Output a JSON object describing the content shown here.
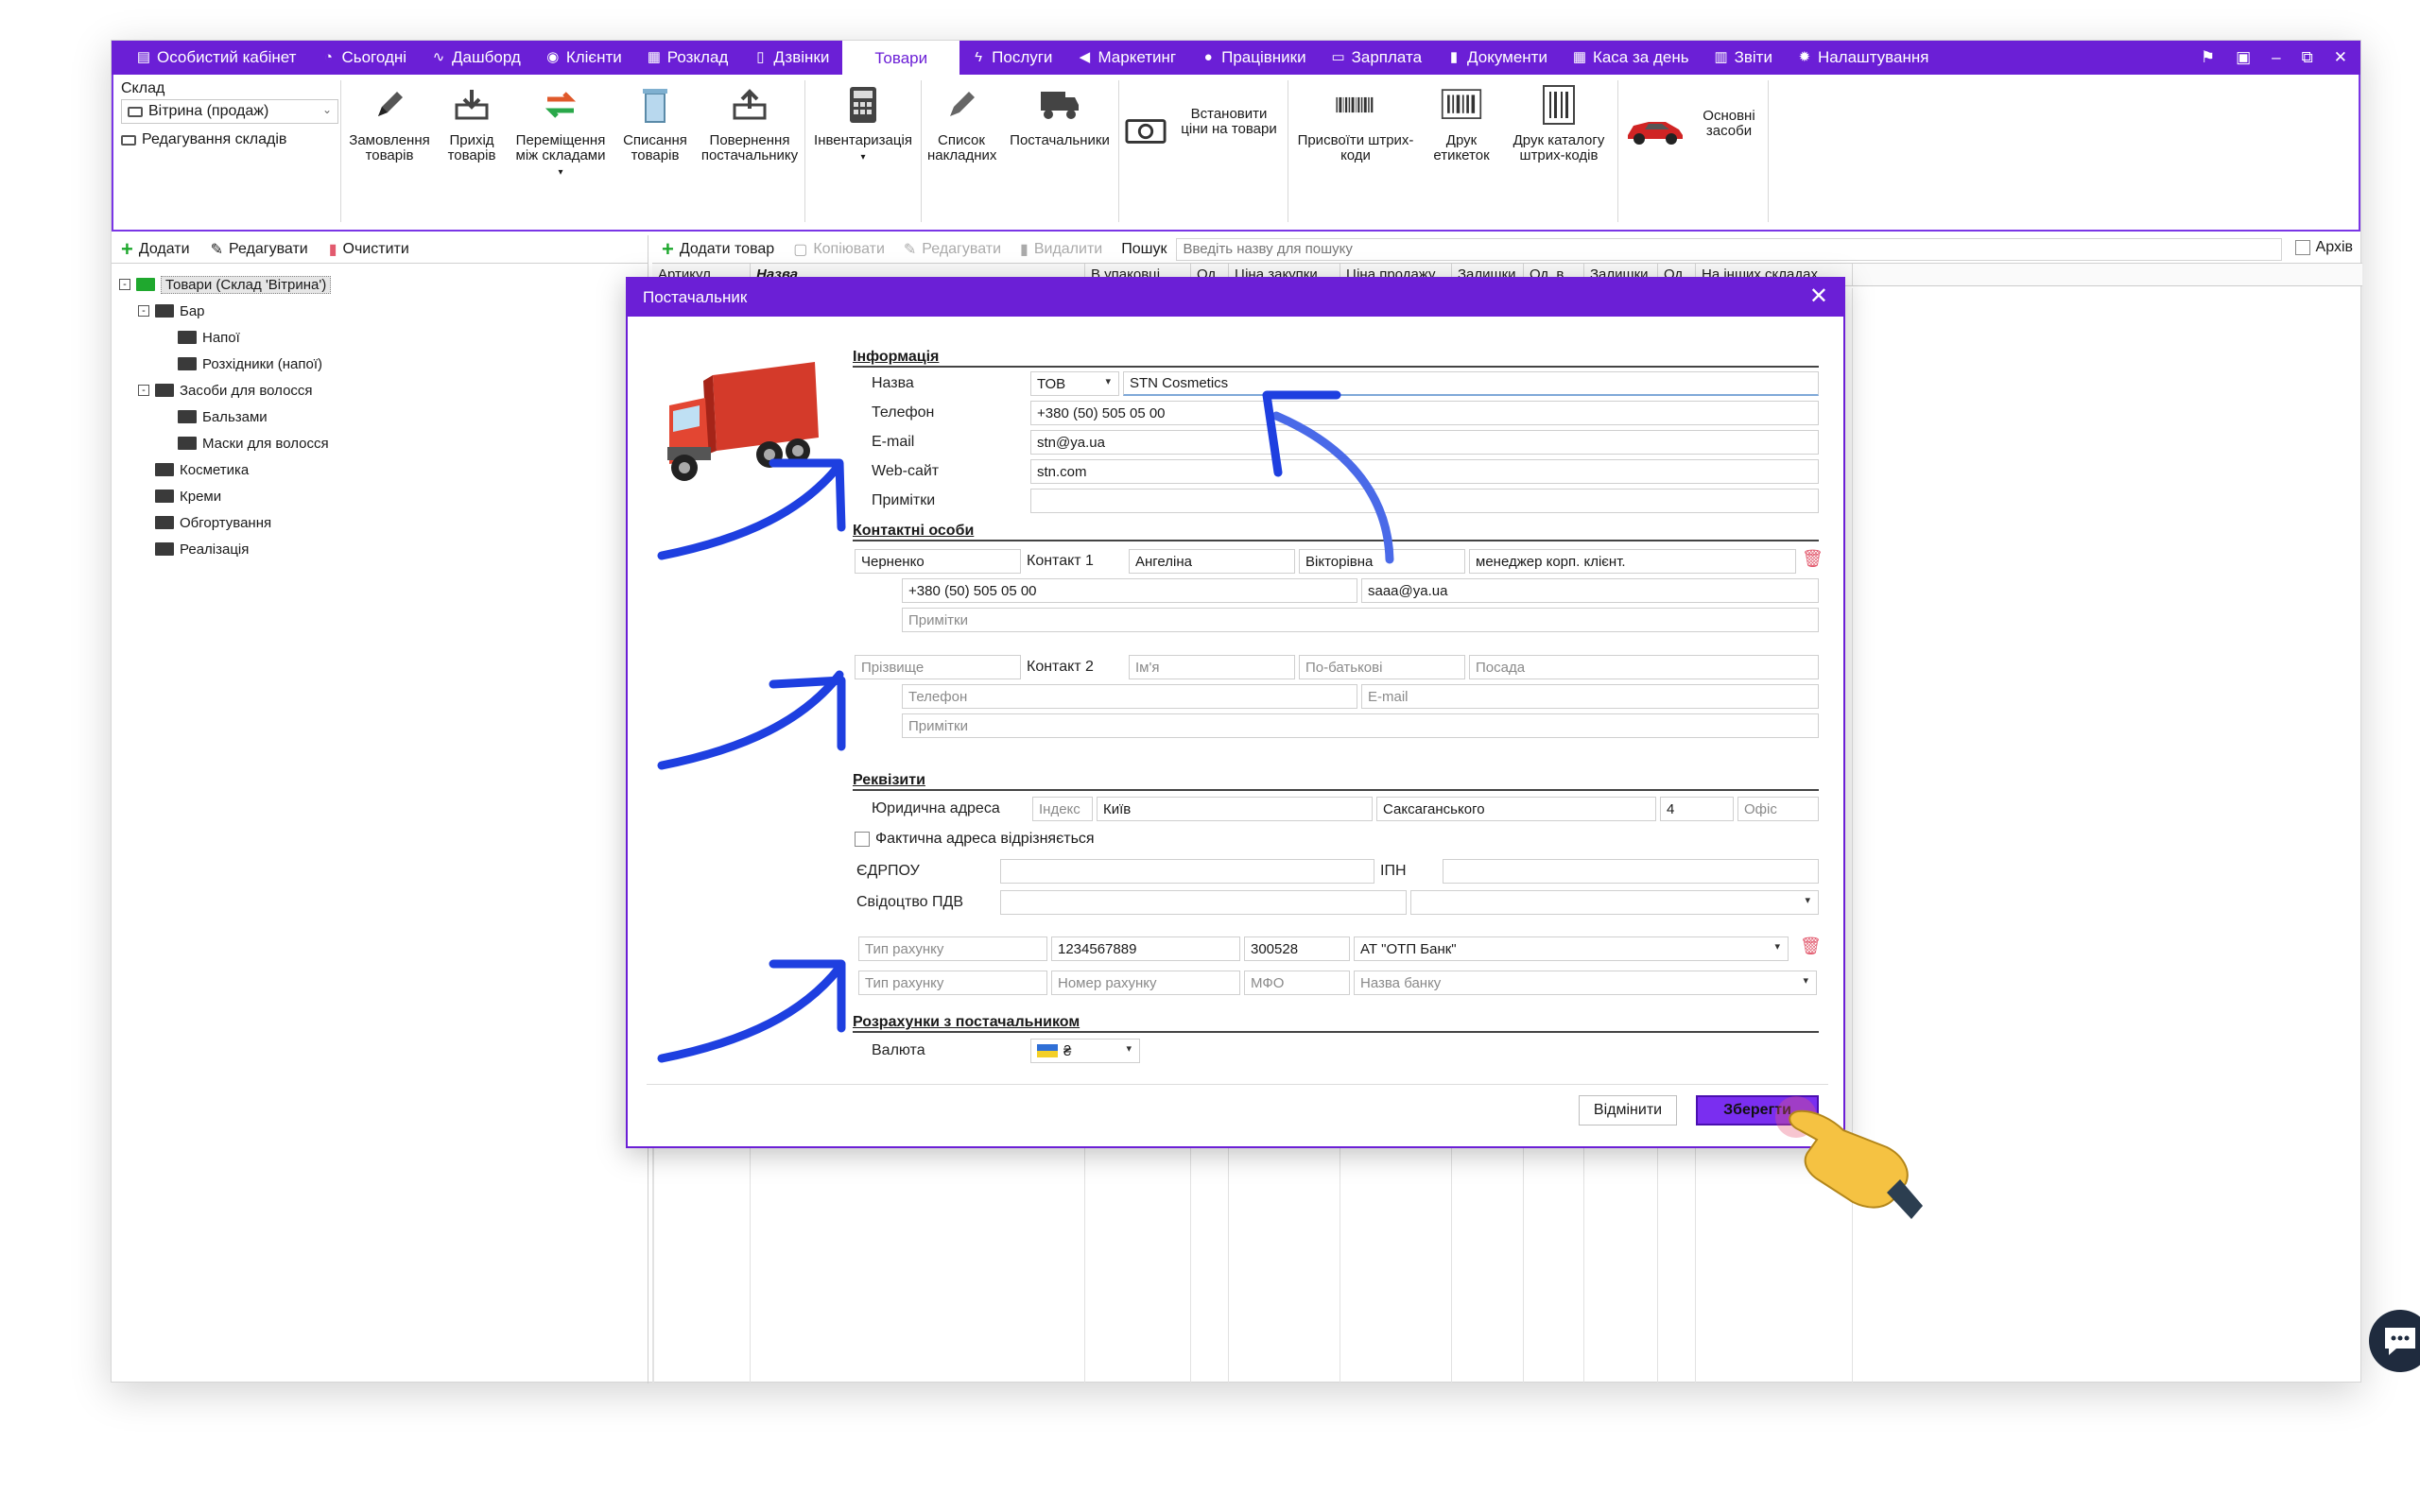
{
  "topnav": {
    "items": [
      {
        "label": "Особистий кабінет",
        "icon": "briefcase-icon"
      },
      {
        "label": "Сьогодні",
        "icon": "clock-icon"
      },
      {
        "label": "Дашборд",
        "icon": "pulse-icon"
      },
      {
        "label": "Клієнти",
        "icon": "user-circle-icon"
      },
      {
        "label": "Розклад",
        "icon": "calendar-icon"
      },
      {
        "label": "Дзвінки",
        "icon": "phone-icon"
      },
      {
        "label": "Товари",
        "icon": "",
        "active": true
      },
      {
        "label": "Послуги",
        "icon": "lightning-icon"
      },
      {
        "label": "Маркетинг",
        "icon": "megaphone-icon"
      },
      {
        "label": "Працівники",
        "icon": "person-icon"
      },
      {
        "label": "Зарплата",
        "icon": "money-icon"
      },
      {
        "label": "Документи",
        "icon": "document-icon"
      },
      {
        "label": "Каса за день",
        "icon": "calculator-icon"
      },
      {
        "label": "Звіти",
        "icon": "bar-chart-icon"
      },
      {
        "label": "Налаштування",
        "icon": "gear-icon"
      }
    ]
  },
  "ribbon": {
    "warehouse_label": "Склад",
    "warehouse_value": "Вітрина (продаж)",
    "edit_warehouses": "Редагування складів",
    "tools": [
      {
        "label": "Замовлення товарів",
        "icon": "pencil-icon"
      },
      {
        "label": "Прихід товарів",
        "icon": "inbox-in-icon"
      },
      {
        "label": "Переміщення між складами",
        "icon": "transfer-icon"
      },
      {
        "label": "Списання товарів",
        "icon": "trash-can-icon"
      },
      {
        "label": "Повернення постачальнику",
        "icon": "return-icon"
      },
      {
        "label": "Інвентаризація",
        "icon": "calculator-icon"
      },
      {
        "label": "Список накладних",
        "icon": "list-pencil-icon"
      },
      {
        "label": "Постачальники",
        "icon": "truck-icon"
      },
      {
        "label": "Встановити ціни на товари",
        "icon": "cash-icon"
      },
      {
        "label": "Присвоїти штрих-коди",
        "icon": "barcode-icon"
      },
      {
        "label": "Друк етикеток",
        "icon": "label-barcode-icon"
      },
      {
        "label": "Друк каталогу штрих-кодів",
        "icon": "catalog-barcode-icon"
      },
      {
        "label": "Основні засоби",
        "icon": "car-icon"
      }
    ]
  },
  "left": {
    "add": "Додати",
    "edit": "Редагувати",
    "clear": "Очистити",
    "tree": [
      {
        "label": "Товари (Склад 'Вітрина')",
        "level": 0,
        "expander": "-",
        "root": true
      },
      {
        "label": "Бар",
        "level": 1,
        "expander": "-"
      },
      {
        "label": "Напої",
        "level": 2
      },
      {
        "label": "Розхідники (напої)",
        "level": 2
      },
      {
        "label": "Засоби для волосся",
        "level": 1,
        "expander": "-"
      },
      {
        "label": "Бальзами",
        "level": 2
      },
      {
        "label": "Маски для волосся",
        "level": 2
      },
      {
        "label": "Косметика",
        "level": 1
      },
      {
        "label": "Креми",
        "level": 1
      },
      {
        "label": "Обгортування",
        "level": 1
      },
      {
        "label": "Реалізація",
        "level": 1
      }
    ]
  },
  "right": {
    "add_product": "Додати товар",
    "copy": "Копіювати",
    "edit": "Редагувати",
    "delete": "Видалити",
    "search_label": "Пошук",
    "search_placeholder": "Введіть назву для пошуку",
    "archive": "Архів",
    "columns": [
      "Артикул",
      "Назва",
      "В упаковці",
      "Од...",
      "Ціна закупки",
      "Ціна продажу",
      "Залишки",
      "Од. в...",
      "Залишки",
      "Од...",
      "На інших складах"
    ]
  },
  "modal": {
    "title": "Постачальник",
    "sec_info": "Інформація",
    "name_label": "Назва",
    "name_type": "ТОВ",
    "name_value": "STN Cosmetics",
    "phone_label": "Телефон",
    "phone_value": "+380 (50) 505 05 00",
    "email_label": "E-mail",
    "email_value": "stn@ya.ua",
    "web_label": "Web-сайт",
    "web_value": "stn.com",
    "notes_label": "Примітки",
    "sec_contacts": "Контактні особи",
    "c1": {
      "surname": "Черненко",
      "label": "Контакт 1",
      "name": "Ангеліна",
      "patronymic": "Вікторівна",
      "position": "менеджер корп. клієнт.",
      "phone": "+380 (50) 505 05 00",
      "email": "saaa@ya.ua",
      "notes_ph": "Примітки"
    },
    "c2": {
      "surname_ph": "Прізвище",
      "label": "Контакт 2",
      "name_ph": "Ім'я",
      "patronymic_ph": "По-батькові",
      "position_ph": "Посада",
      "phone_ph": "Телефон",
      "email_ph": "E-mail",
      "notes_ph": "Примітки"
    },
    "sec_req": "Реквізити",
    "legal_addr_label": "Юридична адреса",
    "index_ph": "Індекс",
    "city": "Київ",
    "street": "Саксаганського",
    "house": "4",
    "office_ph": "Офіс",
    "actual_addr": "Фактична адреса відрізняється",
    "edrpou_label": "ЄДРПОУ",
    "ipn_label": "ІПН",
    "vat_label": "Свідоцтво ПДВ",
    "acc1": {
      "type_ph": "Тип рахунку",
      "number": "1234567889",
      "mfo": "300528",
      "bank": "АТ \"ОТП Банк\""
    },
    "acc2": {
      "type_ph": "Тип рахунку",
      "number_ph": "Номер рахунку",
      "mfo_ph": "МФО",
      "bank_ph": "Назва банку"
    },
    "sec_settle": "Розрахунки з постачальником",
    "currency_label": "Валюта",
    "currency_value": "₴",
    "cancel": "Відмінити",
    "save": "Зберегти"
  },
  "colors": {
    "accent": "#6b1fd6",
    "arrow": "#1e3fe0",
    "trash": "#e25a6e"
  }
}
